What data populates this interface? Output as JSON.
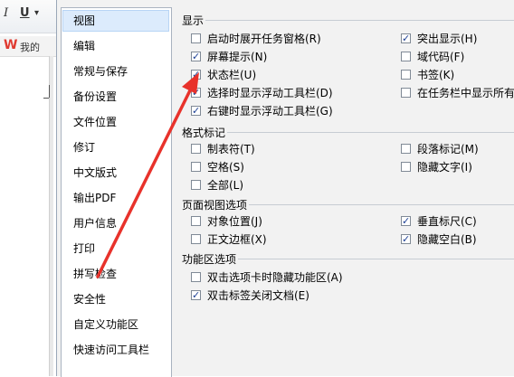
{
  "background": {
    "toolbar": {
      "italic": "I",
      "underline": "U",
      "dropdown": "▾"
    },
    "tab": {
      "logo": "W",
      "doc": "我的"
    }
  },
  "nav": {
    "items": [
      {
        "label": "视图",
        "selected": true
      },
      {
        "label": "编辑"
      },
      {
        "label": "常规与保存"
      },
      {
        "label": "备份设置"
      },
      {
        "label": "文件位置"
      },
      {
        "label": "修订"
      },
      {
        "label": "中文版式"
      },
      {
        "label": "输出PDF"
      },
      {
        "label": "用户信息"
      },
      {
        "label": "打印"
      },
      {
        "label": "拼写检查"
      },
      {
        "label": "安全性"
      },
      {
        "label": "自定义功能区"
      },
      {
        "label": "快速访问工具栏"
      }
    ]
  },
  "sections": {
    "display": {
      "title": "显示",
      "options": [
        {
          "label": "启动时展开任务窗格(R)",
          "checked": false
        },
        {
          "label": "屏幕提示(N)",
          "checked": true
        },
        {
          "label": "状态栏(U)",
          "checked": true
        },
        {
          "label": "选择时显示浮动工具栏(D)",
          "checked": true
        },
        {
          "label": "右键时显示浮动工具栏(G)",
          "checked": true
        },
        {
          "label": "突出显示(H)",
          "checked": true
        },
        {
          "label": "域代码(F)",
          "checked": false
        },
        {
          "label": "书签(K)",
          "checked": false
        },
        {
          "label": "在任务栏中显示所有窗口",
          "checked": false
        }
      ]
    },
    "format_marks": {
      "title": "格式标记",
      "options": [
        {
          "label": "制表符(T)",
          "checked": false
        },
        {
          "label": "空格(S)",
          "checked": false
        },
        {
          "label": "全部(L)",
          "checked": false
        },
        {
          "label": "段落标记(M)",
          "checked": false
        },
        {
          "label": "隐藏文字(I)",
          "checked": false
        }
      ]
    },
    "page_view": {
      "title": "页面视图选项",
      "options": [
        {
          "label": "对象位置(J)",
          "checked": false
        },
        {
          "label": "正文边框(X)",
          "checked": false
        },
        {
          "label": "垂直标尺(C)",
          "checked": true
        },
        {
          "label": "隐藏空白(B)",
          "checked": true
        }
      ]
    },
    "ribbon": {
      "title": "功能区选项",
      "options": [
        {
          "label": "双击选项卡时隐藏功能区(A)",
          "checked": false
        },
        {
          "label": "双击标签关闭文档(E)",
          "checked": true
        }
      ]
    }
  },
  "colors": {
    "arrow": "#e8322b",
    "selected_bg": "#dcebfc",
    "check": "#1c3f94"
  }
}
